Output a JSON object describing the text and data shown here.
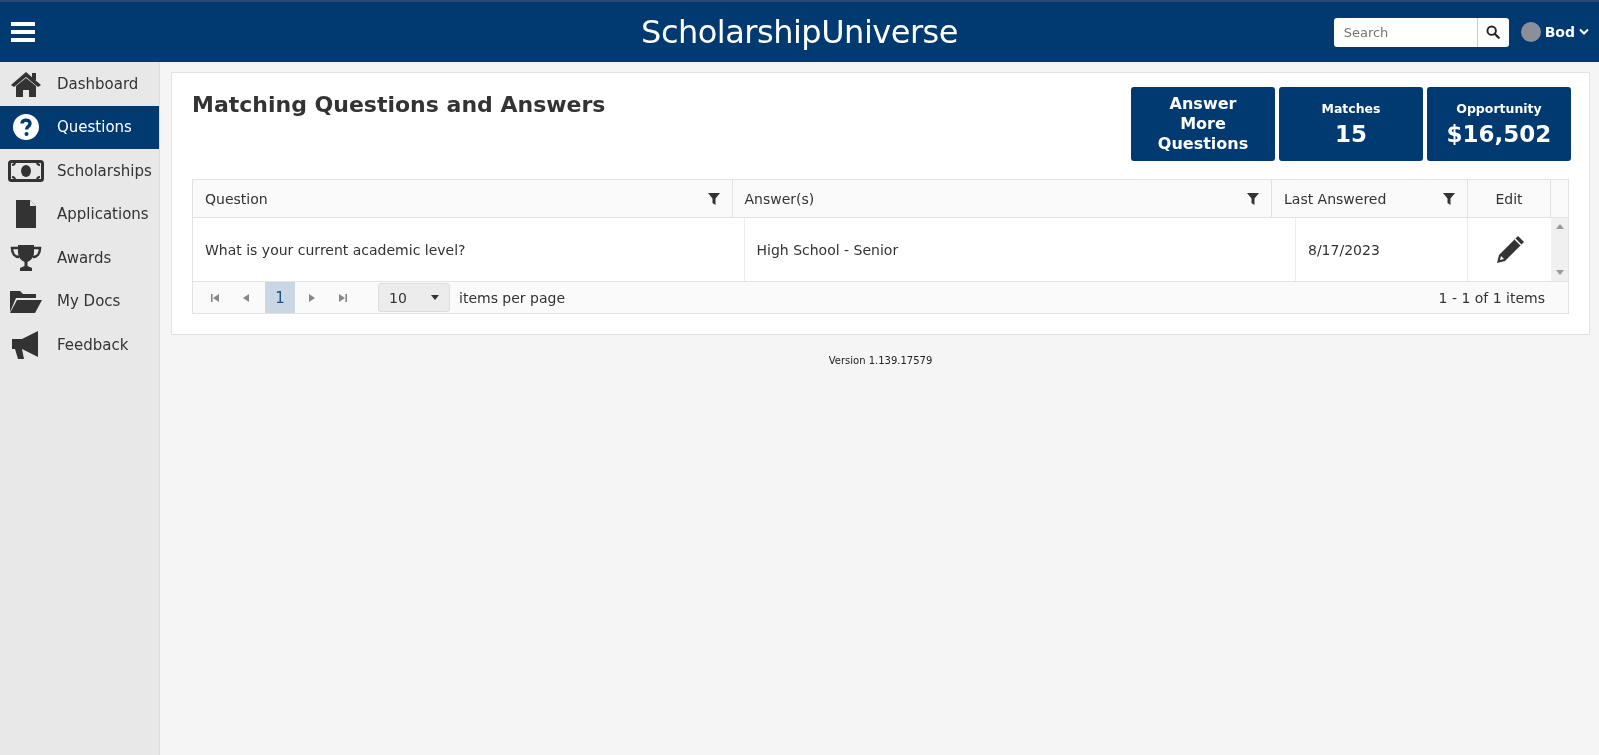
{
  "header": {
    "title": "ScholarshipUniverse",
    "search": {
      "placeholder": "Search"
    },
    "user": {
      "name": "Bod"
    }
  },
  "sidebar": {
    "items": [
      {
        "label": "Dashboard",
        "selected": false
      },
      {
        "label": "Questions",
        "selected": true
      },
      {
        "label": "Scholarships",
        "selected": false
      },
      {
        "label": "Applications",
        "selected": false
      },
      {
        "label": "Awards",
        "selected": false
      },
      {
        "label": "My Docs",
        "selected": false
      },
      {
        "label": "Feedback",
        "selected": false
      }
    ]
  },
  "page": {
    "title": "Matching Questions and Answers",
    "stats": [
      {
        "kind": "action",
        "label": "Answer More Questions"
      },
      {
        "kind": "stat",
        "label": "Matches",
        "value": "15"
      },
      {
        "kind": "stat",
        "label": "Opportunity",
        "value": "$16,502"
      }
    ]
  },
  "table": {
    "columns": [
      {
        "label": "Question",
        "filterable": true
      },
      {
        "label": "Answer(s)",
        "filterable": true
      },
      {
        "label": "Last Answered",
        "filterable": true
      },
      {
        "label": "Edit",
        "filterable": false
      }
    ],
    "rows": [
      {
        "question": "What is your current academic level?",
        "answer": "High School - Senior",
        "last_answered": "8/17/2023"
      }
    ]
  },
  "pager": {
    "pages": [
      {
        "label": "1",
        "selected": true
      }
    ],
    "page_size": "10",
    "page_size_label": "items per page",
    "summary": "1 - 1 of 1 items"
  },
  "footer": {
    "version": "Version 1.139.17579"
  }
}
